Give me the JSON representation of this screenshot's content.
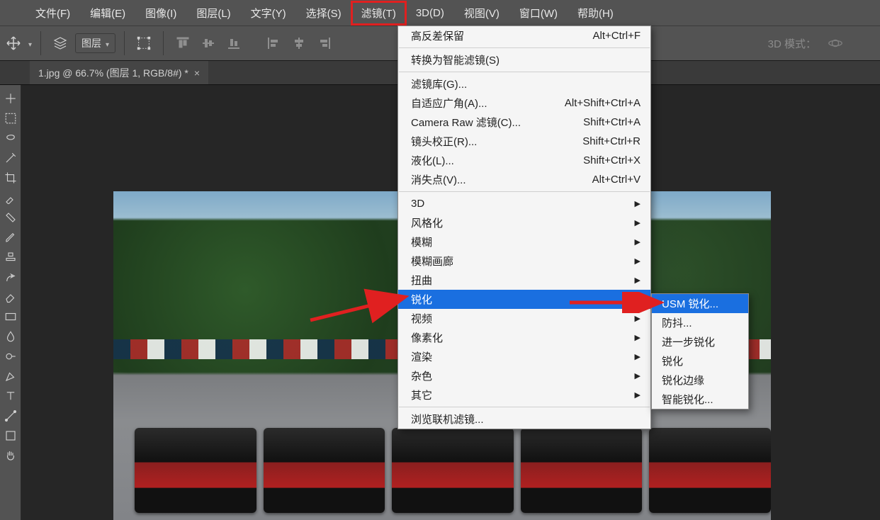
{
  "menubar": {
    "items": [
      {
        "label": "文件(F)"
      },
      {
        "label": "编辑(E)"
      },
      {
        "label": "图像(I)"
      },
      {
        "label": "图层(L)"
      },
      {
        "label": "文字(Y)"
      },
      {
        "label": "选择(S)"
      },
      {
        "label": "滤镜(T)"
      },
      {
        "label": "3D(D)"
      },
      {
        "label": "视图(V)"
      },
      {
        "label": "窗口(W)"
      },
      {
        "label": "帮助(H)"
      }
    ],
    "active_index": 6
  },
  "optionsbar": {
    "layer_select_label": "图层",
    "mode3d_label": "3D 模式："
  },
  "doc_tab": {
    "title": "1.jpg @ 66.7% (图层 1, RGB/8#) *",
    "close": "×"
  },
  "filter_menu": {
    "groups": [
      [
        {
          "label": "高反差保留",
          "shortcut": "Alt+Ctrl+F"
        }
      ],
      [
        {
          "label": "转换为智能滤镜(S)"
        }
      ],
      [
        {
          "label": "滤镜库(G)..."
        },
        {
          "label": "自适应广角(A)...",
          "shortcut": "Alt+Shift+Ctrl+A"
        },
        {
          "label": "Camera Raw 滤镜(C)...",
          "shortcut": "Shift+Ctrl+A"
        },
        {
          "label": "镜头校正(R)...",
          "shortcut": "Shift+Ctrl+R"
        },
        {
          "label": "液化(L)...",
          "shortcut": "Shift+Ctrl+X"
        },
        {
          "label": "消失点(V)...",
          "shortcut": "Alt+Ctrl+V"
        }
      ],
      [
        {
          "label": "3D",
          "sub": true
        },
        {
          "label": "风格化",
          "sub": true
        },
        {
          "label": "模糊",
          "sub": true
        },
        {
          "label": "模糊画廊",
          "sub": true
        },
        {
          "label": "扭曲",
          "sub": true
        },
        {
          "label": "锐化",
          "sub": true,
          "highlight": true
        },
        {
          "label": "视频",
          "sub": true
        },
        {
          "label": "像素化",
          "sub": true
        },
        {
          "label": "渲染",
          "sub": true
        },
        {
          "label": "杂色",
          "sub": true
        },
        {
          "label": "其它",
          "sub": true
        }
      ],
      [
        {
          "label": "浏览联机滤镜..."
        }
      ]
    ]
  },
  "sharpen_submenu": {
    "items": [
      {
        "label": "USM 锐化...",
        "highlight": true
      },
      {
        "label": "防抖..."
      },
      {
        "label": "进一步锐化"
      },
      {
        "label": "锐化"
      },
      {
        "label": "锐化边缘"
      },
      {
        "label": "智能锐化..."
      }
    ]
  },
  "icons": {
    "move": "move-icon",
    "layers": "layers-icon",
    "auto_select": "auto-select-icon"
  }
}
